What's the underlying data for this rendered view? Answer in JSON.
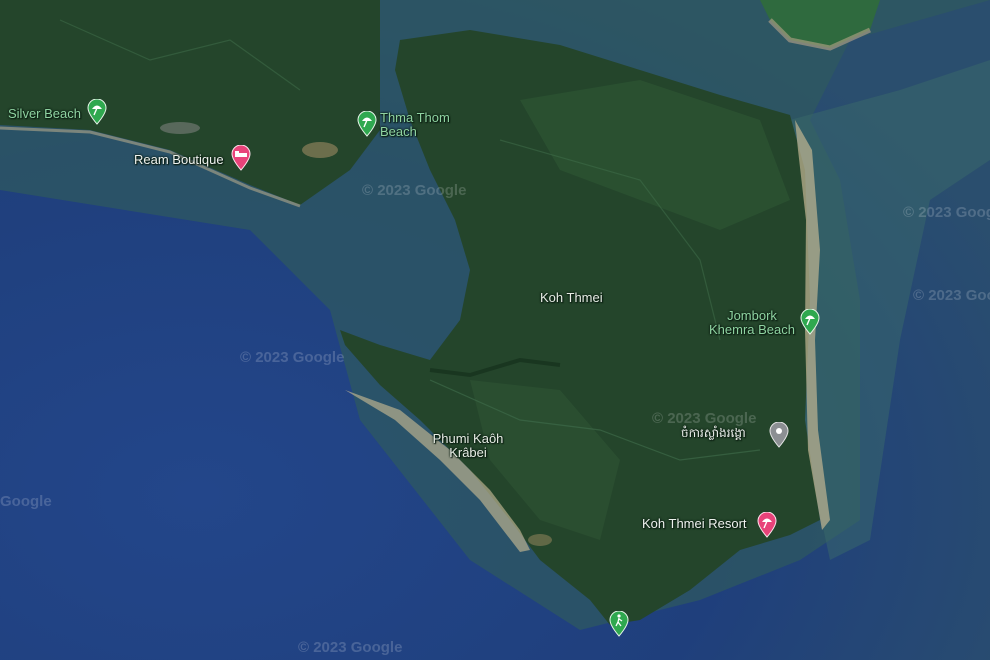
{
  "map": {
    "colors": {
      "deep_water": "#1f3f7c",
      "shallow_water": "#2f5a6a",
      "land": "#24452b",
      "land_light": "#2f5a35",
      "beach": "#b9b08f",
      "pin_green": "#2fa84f",
      "pin_pink": "#e8437a",
      "pin_gray": "#8c8f93"
    },
    "places": {
      "silver_beach": "Silver Beach",
      "thma_thom_1": "Thma Thom",
      "thma_thom_2": "Beach",
      "ream_boutique": "Ream Boutique",
      "koh_thmei": "Koh Thmei",
      "jombork_1": "Jombork",
      "jombork_2": "Khemra Beach",
      "khmer_label": "ចំការស្លាំងរង្គោ",
      "phumi_1": "Phumi Kaôh",
      "phumi_2": "Krâbei",
      "resort": "Koh Thmei Resort"
    },
    "icons": {
      "beach": "beach-umbrella-icon",
      "hotel": "hotel-bed-icon",
      "place": "map-pin-icon",
      "hike": "hiking-icon"
    },
    "watermarks": {
      "copyright": "© 2023 Google",
      "google": "Google"
    }
  }
}
